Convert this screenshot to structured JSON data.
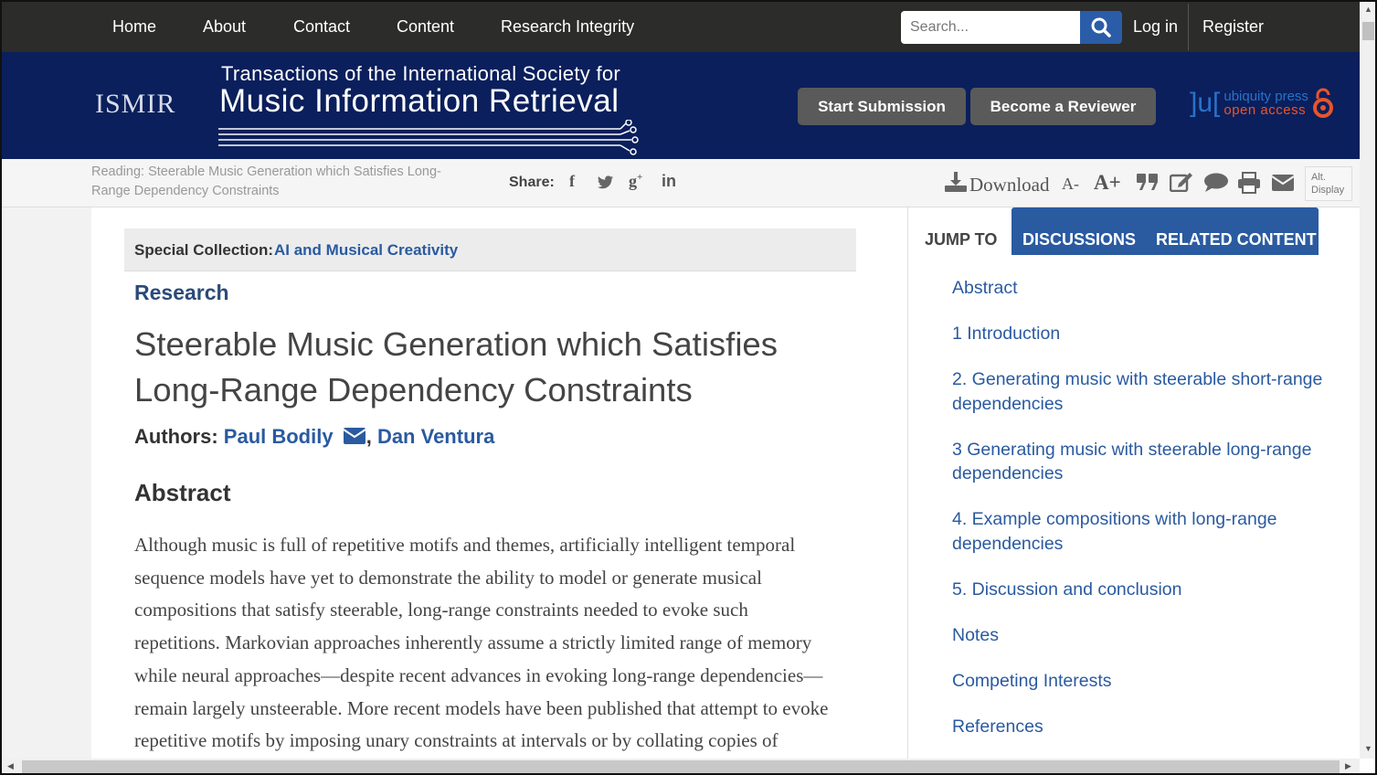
{
  "nav": {
    "items": [
      "Home",
      "About",
      "Contact",
      "Content",
      "Research Integrity"
    ],
    "search_placeholder": "Search...",
    "login": "Log in",
    "register": "Register"
  },
  "banner": {
    "logo_text": "ISMIR",
    "journal_sub": "Transactions of the International Society for",
    "journal_main": "Music Information Retrieval",
    "start_submission": "Start Submission",
    "become_reviewer": "Become a Reviewer",
    "publisher_brace": "]u[",
    "publisher_line1": "ubiquity press",
    "publisher_line2": "open access"
  },
  "toolbar": {
    "reading": "Reading: Steerable Music Generation which Satisfies Long-Range Dependency Constraints",
    "share_label": "Share:",
    "share_icons": [
      "facebook-icon",
      "twitter-icon",
      "google-plus-icon",
      "linkedin-icon"
    ],
    "download_label": "Download",
    "font_decrease": "A-",
    "font_increase": "A+",
    "alt_display": "Alt. Display"
  },
  "article": {
    "collection_label": "Special Collection:",
    "collection_value": "AI and Musical Creativity",
    "type": "Research",
    "title": "Steerable Music Generation which Satisfies Long-Range Dependency Constraints",
    "authors_label": "Authors:",
    "author1": "Paul Bodily",
    "author2": "Dan Ventura",
    "abstract_heading": "Abstract",
    "abstract_lines": [
      "Although music is full of repetitive motifs and themes, artificially intelligent temporal",
      "sequence models have yet to demonstrate the ability to model or generate musical",
      "compositions that satisfy steerable, long-range constraints needed to evoke such",
      "repetitions. Markovian approaches inherently assume a strictly limited range of memory",
      "while neural approaches—despite recent advances in evoking long-range dependencies—",
      "remain largely unsteerable. More recent models have been published that attempt to evoke",
      "repetitive motifs by imposing unary constraints at intervals or by collating copies of"
    ]
  },
  "sidebar": {
    "tabs": {
      "jump_to": "JUMP TO",
      "discussions": "DISCUSSIONS",
      "related": "RELATED CONTENT"
    },
    "toc": [
      "Abstract",
      "1 Introduction",
      "2. Generating music with steerable short-range dependencies",
      "3 Generating music with steerable long-range dependencies",
      "4. Example compositions with long-range dependencies",
      "5. Discussion and conclusion",
      "Notes",
      "Competing Interests",
      "References"
    ]
  },
  "colors": {
    "nav_bg": "#2c2c2a",
    "banner_bg": "#0a1f5c",
    "link": "#2a5aa0",
    "tab_active_bg": "#2a5aa0",
    "search_button": "#2a5ca8"
  }
}
